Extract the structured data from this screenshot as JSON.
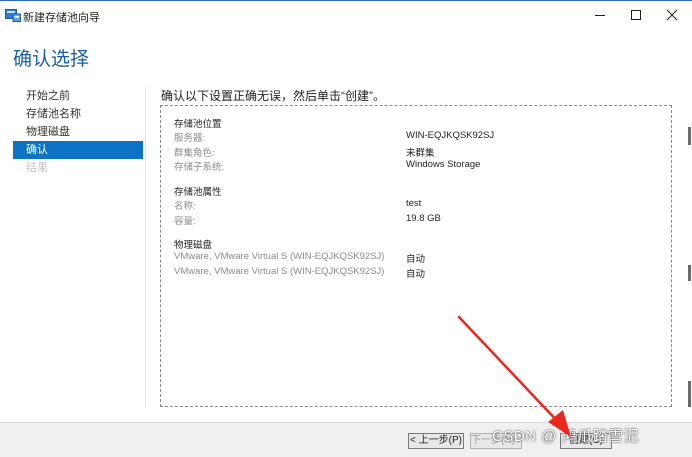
{
  "window": {
    "title": "新建存储池向导"
  },
  "heading": "确认选择",
  "nav": {
    "items": [
      {
        "label": "开始之前",
        "state": "normal"
      },
      {
        "label": "存储池名称",
        "state": "normal"
      },
      {
        "label": "物理磁盘",
        "state": "normal"
      },
      {
        "label": "确认",
        "state": "active"
      },
      {
        "label": "结果",
        "state": "disabled"
      }
    ]
  },
  "prompt": "确认以下设置正确无误，然后单击“创建”。",
  "summary": {
    "location": {
      "title": "存储池位置",
      "rows": [
        {
          "label": "服务器:",
          "value": "WIN-EQJKQSK92SJ"
        },
        {
          "label": "群集角色:",
          "value": "未群集"
        },
        {
          "label": "存储子系统:",
          "value": "Windows Storage"
        }
      ]
    },
    "properties": {
      "title": "存储池属性",
      "rows": [
        {
          "label": "名称:",
          "value": "test"
        },
        {
          "label": "容量:",
          "value": "19.8 GB"
        }
      ]
    },
    "disks": {
      "title": "物理磁盘",
      "rows": [
        {
          "label": "VMware, VMware Virtual S (WIN-EQJKQSK92SJ)",
          "value": "自动"
        },
        {
          "label": "VMware, VMware Virtual S (WIN-EQJKQSK92SJ)",
          "value": "自动"
        }
      ]
    }
  },
  "buttons": {
    "prev": "< 上一步(P)",
    "next": "下一步(N) >",
    "create": "创建(C)"
  },
  "watermark": "CSDN @ 鸿爪踏雪泥",
  "colors": {
    "accent": "#0d72c4",
    "heading": "#1a5ea8",
    "annotation_arrow": "#e8281e"
  },
  "icons": {
    "app": "server-manager-icon",
    "minimize": "minimize-icon",
    "maximize": "maximize-icon",
    "close": "close-icon"
  }
}
